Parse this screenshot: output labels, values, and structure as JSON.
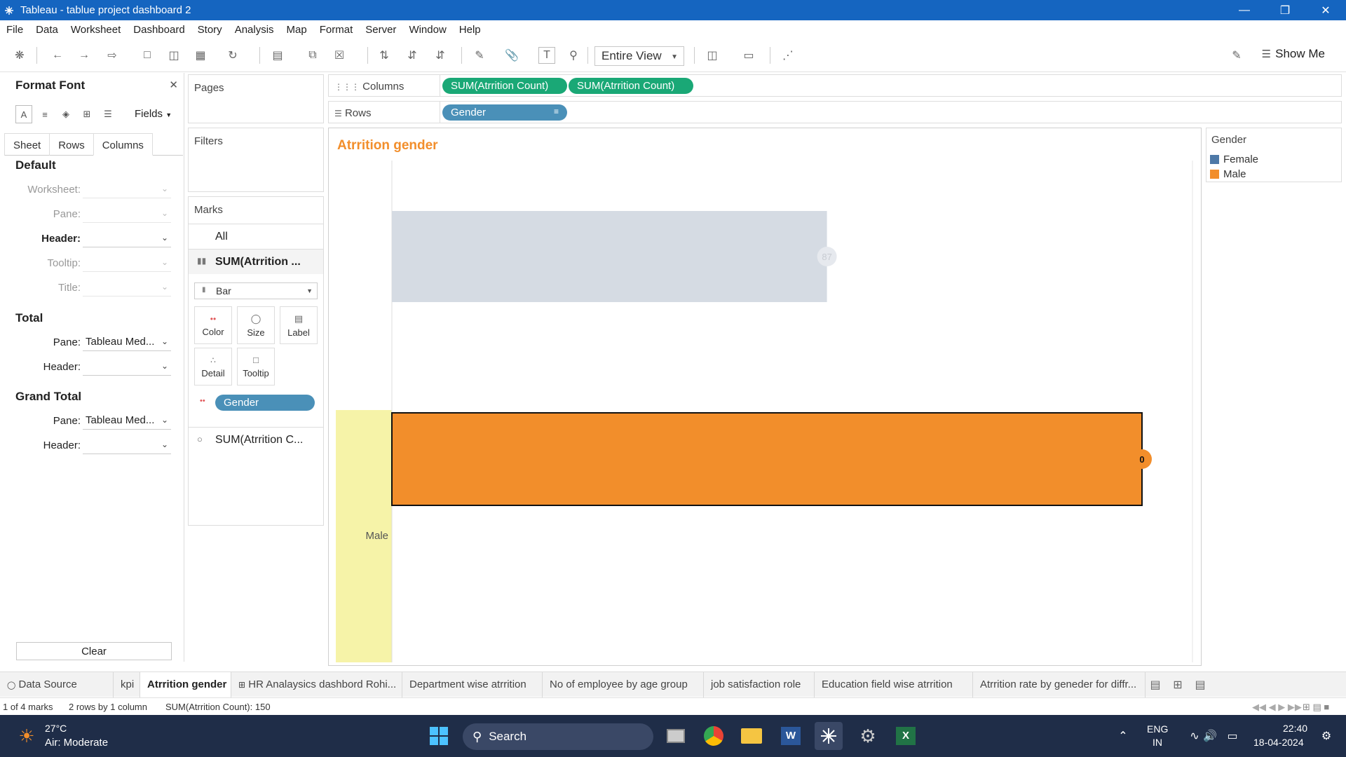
{
  "window": {
    "title": "Tableau - tablue project dashboard 2"
  },
  "menu": [
    "File",
    "Data",
    "Worksheet",
    "Dashboard",
    "Story",
    "Analysis",
    "Map",
    "Format",
    "Server",
    "Window",
    "Help"
  ],
  "toolbar": {
    "fit": "Entire View",
    "show_me": "Show Me"
  },
  "format_pane": {
    "title": "Format Font",
    "fields": "Fields",
    "tabs": [
      "Sheet",
      "Rows",
      "Columns"
    ],
    "active_tab": "Columns",
    "default": {
      "heading": "Default",
      "worksheet": "Worksheet:",
      "pane": "Pane:",
      "header": "Header:",
      "tooltip": "Tooltip:",
      "title": "Title:"
    },
    "total": {
      "heading": "Total",
      "pane": "Pane:",
      "pane_value": "Tableau Med...",
      "header": "Header:"
    },
    "grand_total": {
      "heading": "Grand Total",
      "pane": "Pane:",
      "pane_value": "Tableau Med...",
      "header": "Header:"
    },
    "clear": "Clear"
  },
  "shelves": {
    "pages": "Pages",
    "filters": "Filters",
    "marks": "Marks",
    "marks_all": "All",
    "marks_card1": "SUM(Atrrition ...",
    "mark_type": "Bar",
    "buttons": {
      "color": "Color",
      "size": "Size",
      "label": "Label",
      "detail": "Detail",
      "tooltip": "Tooltip"
    },
    "gender_pill": "Gender",
    "marks_card2": "SUM(Atrrition C...",
    "columns_label": "Columns",
    "rows_label": "Rows",
    "columns_pills": [
      "SUM(Atrrition Count)",
      "SUM(Atrrition Count)"
    ],
    "rows_pill": "Gender"
  },
  "view": {
    "title": "Atrrition gender",
    "row_label_male": "Male",
    "female_value": "87",
    "male_value": "0"
  },
  "chart_data": {
    "type": "bar",
    "title": "Atrrition gender",
    "categories": [
      "Female",
      "Male"
    ],
    "values": [
      87,
      150
    ],
    "bar_colors": [
      "#d5dbe3",
      "#f28e2b"
    ],
    "labels": [
      "87",
      "0"
    ]
  },
  "legend": {
    "title": "Gender",
    "items": [
      {
        "label": "Female",
        "color": "#4e79a7"
      },
      {
        "label": "Male",
        "color": "#f28e2b"
      }
    ]
  },
  "sheet_tabs": {
    "data_source": "Data Source",
    "tabs": [
      "kpi",
      "Atrrition gender",
      "HR Analaysics dashbord Rohi...",
      "Department wise atrrition",
      "No of employee by age group",
      "job satisfaction role",
      "Education field wise atrrition",
      "Atrrition rate by geneder for diffr..."
    ],
    "active": "Atrrition gender"
  },
  "status": {
    "marks": "1 of 4 marks",
    "dims": "2 rows by 1 column",
    "sum": "SUM(Atrrition Count): 150"
  },
  "taskbar": {
    "temp": "27°C",
    "air": "Air: Moderate",
    "search": "Search",
    "lang1": "ENG",
    "lang2": "IN",
    "time": "22:40",
    "date": "18-04-2024"
  }
}
